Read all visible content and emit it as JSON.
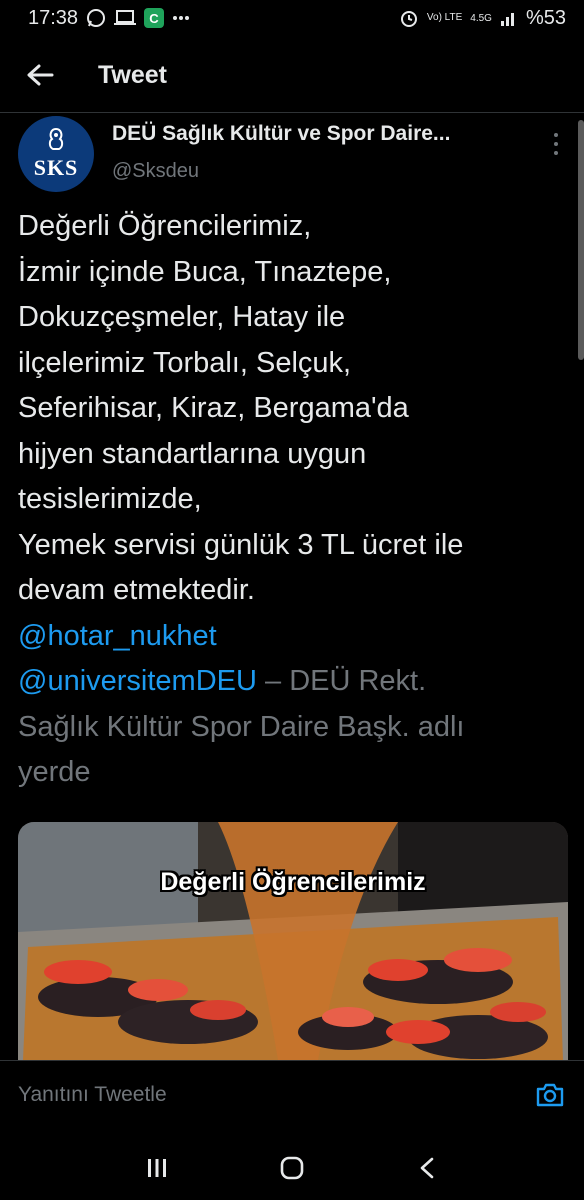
{
  "status_bar": {
    "time": "17:38",
    "left_icons": [
      "whatsapp-icon",
      "laptop-icon",
      "app-c-icon",
      "more-dots-icon"
    ],
    "right_icons": [
      "alarm-icon",
      "volte-icon",
      "signal-4g-icon",
      "signal-bars-icon"
    ],
    "volte_label": "Vo) LTE",
    "network_label": "4.5G",
    "battery": "%53"
  },
  "header": {
    "title": "Tweet",
    "back_icon": "arrow-left-icon"
  },
  "tweet": {
    "author": {
      "display_name": "DEÜ Sağlık Kültür ve Spor Daire...",
      "handle": "@Sksdeu",
      "avatar_text": "SKS"
    },
    "lines": [
      "Değerli Öğrencilerimiz,",
      "İzmir içinde Buca, Tınaztepe,",
      "Dokuzçeşmeler, Hatay ile",
      "ilçelerimiz Torbalı, Selçuk,",
      "Seferihisar, Kiraz, Bergama'da",
      "hijyen standartlarına uygun",
      "tesislerimizde,",
      "Yemek servisi günlük 3 TL ücret ile",
      "devam etmektedir."
    ],
    "mention_1": "@hotar_nukhet",
    "mention_2": "@universitemDEU",
    "location_prefix": " – DEÜ Rekt.",
    "location_line_2": "Sağlık Kültür Spor Daire Başk. adlı",
    "location_line_3": "yerde",
    "media_caption": "Değerli Öğrencilerimiz"
  },
  "reply": {
    "placeholder": "Yanıtını Tweetle",
    "camera_icon": "camera-icon"
  },
  "system_nav": {
    "buttons": [
      "recents-icon",
      "home-icon",
      "back-icon"
    ]
  },
  "colors": {
    "background": "#000000",
    "text": "#e7e9ea",
    "secondary": "#71767b",
    "link": "#1d9bf0"
  }
}
